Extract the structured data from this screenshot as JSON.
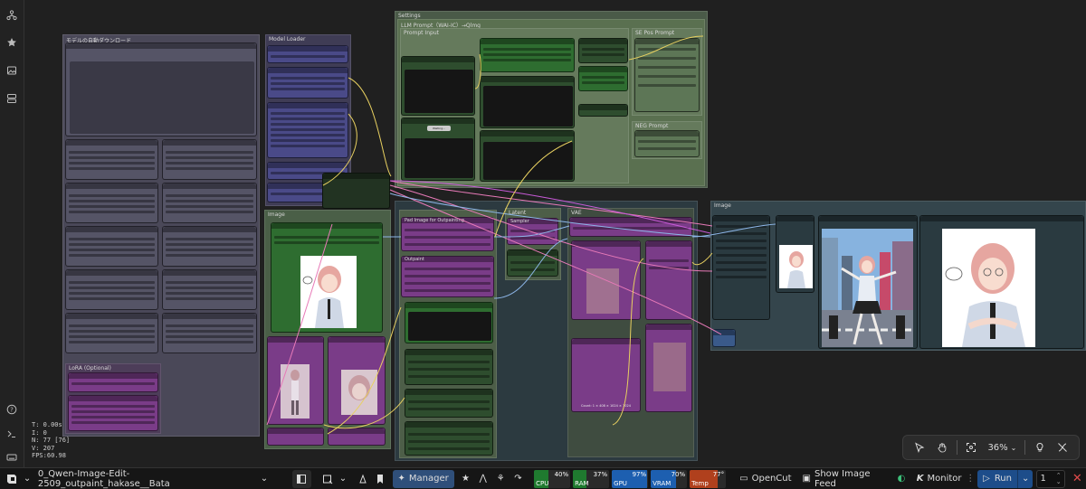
{
  "sidebar": {
    "items": [
      {
        "icon": "node-library-icon"
      },
      {
        "icon": "star-icon"
      },
      {
        "icon": "image-gallery-icon"
      },
      {
        "icon": "workflows-icon"
      }
    ],
    "bottom_items": [
      {
        "icon": "help-icon"
      },
      {
        "icon": "terminal-icon"
      },
      {
        "icon": "keyboard-icon"
      }
    ]
  },
  "canvas": {
    "groups": {
      "model_download": "モデルの自動ダウンロード",
      "model_loader": "Model Loader",
      "settings": "Settings",
      "llm_prompt": "LLM Prompt（WAI-IC）→Qlmg",
      "prompt_input": "Prompt Input",
      "sd_pos_prompt": "SE Pos Prompt",
      "neg_prompt": "NEG Prompt",
      "image": "Image",
      "latent": "Latent",
      "sampler": "Sampler",
      "vae": "VAE",
      "ref": "Ref",
      "lora": "LoRA (Optional)",
      "preview": "Image"
    },
    "node_titles": {
      "pad_image": "Pad Image for Outpainting",
      "outpaint": "Outpaint"
    },
    "small_text": {
      "status_widget": "Waiting...",
      "count_text": "Count: 1 × 408 × 1024 × 1024"
    },
    "stats": {
      "t": "T: 0.00s",
      "i": "I: 0",
      "n": "N: 77 [76]",
      "v": "V: 207",
      "fps": "FPS:60.98"
    }
  },
  "toolbox": {
    "zoom": "36%",
    "tools": [
      "select-icon",
      "hand-pan-icon",
      "fit-view-icon",
      "lightbulb-icon",
      "link-visibility-icon"
    ]
  },
  "bottombar": {
    "workflow_name": "0_Qwen-Image-Edit-2509_outpaint_hakase__Bata",
    "manager_label": "Manager",
    "opencut_label": "OpenCut",
    "feed_label": "Show Image Feed",
    "monitor_label": "Monitor",
    "run_label": "Run",
    "queue_count": "1",
    "meters": [
      {
        "label": "CPU",
        "value": "40%",
        "level": 0.4,
        "color": "#1f7a2f"
      },
      {
        "label": "RAM",
        "value": "37%",
        "level": 0.37,
        "color": "#1f7a2f"
      },
      {
        "label": "GPU",
        "value": "97%",
        "level": 0.97,
        "color": "#1d5fb0"
      },
      {
        "label": "VRAM",
        "value": "70%",
        "level": 0.7,
        "color": "#1d5fb0"
      },
      {
        "label": "Temp",
        "value": "77°",
        "level": 0.77,
        "color": "#b0401d"
      }
    ]
  }
}
